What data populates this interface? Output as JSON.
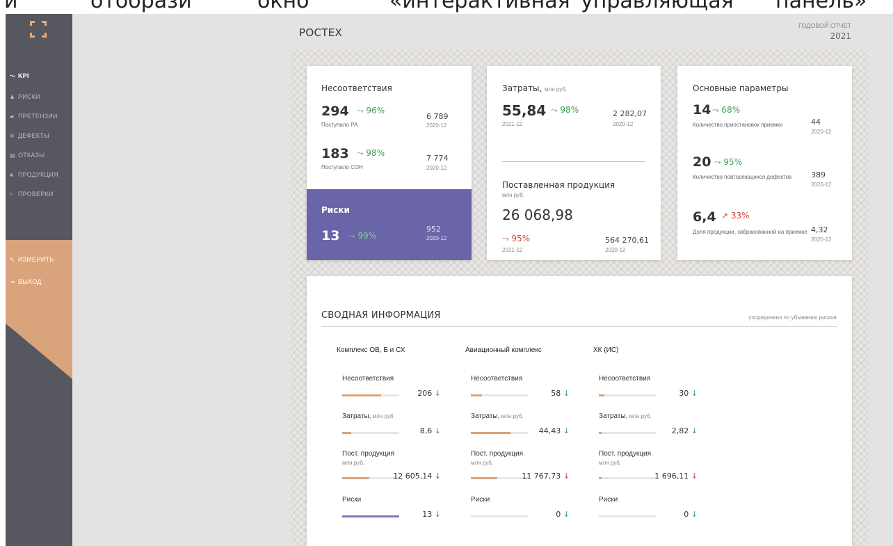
{
  "top_strip": [
    "и",
    "отобрази",
    "окно",
    "«интерактивная",
    "управляющая",
    "панель»"
  ],
  "sidebar": {
    "logo": "frame-logo",
    "items": [
      {
        "icon": "trend-icon",
        "glyph": "〜",
        "label": "KPI",
        "active": true
      },
      {
        "icon": "bell-icon",
        "glyph": "♟",
        "label": "РИСКИ"
      },
      {
        "icon": "speaker-icon",
        "glyph": "▰",
        "label": "ПРЕТЕНЗИИ"
      },
      {
        "icon": "gear-icon",
        "glyph": "✲",
        "label": "ДЕФЕКТЫ"
      },
      {
        "icon": "document-icon",
        "glyph": "▤",
        "label": "ОТКАЗЫ"
      },
      {
        "icon": "boxes-icon",
        "glyph": "♣",
        "label": "ПРОДУКЦИЯ"
      },
      {
        "icon": "waves-icon",
        "glyph": "≈",
        "label": "ПРОВЕРКИ"
      }
    ],
    "actions": [
      {
        "icon": "pencil-icon",
        "glyph": "✎",
        "label": "ИЗМЕНИТЬ"
      },
      {
        "icon": "logout-icon",
        "glyph": "⇥",
        "label": "ВЫХОД"
      }
    ]
  },
  "header": {
    "title": "РОСТЕХ",
    "report_label": "ГОДОВОЙ ОТЧЕТ",
    "report_year": "2021"
  },
  "card1": {
    "title": "Несоответствия",
    "rows": [
      {
        "value": "294",
        "pct": "96%",
        "label": "Поступило РА",
        "ref": "6 789",
        "ref_date": "2020-12"
      },
      {
        "value": "183",
        "pct": "98%",
        "label": "Поступило СОН",
        "ref": "7 774",
        "ref_date": "2020-12"
      }
    ],
    "risk": {
      "title": "Риски",
      "value": "13",
      "pct": "99%",
      "ref": "952",
      "ref_date": "2020-12"
    }
  },
  "card2": {
    "title": "Затраты,",
    "unit": "млн руб.",
    "value": "55,84",
    "pct": "98%",
    "date": "2021-12",
    "ref": "2 282,07",
    "ref_date": "2020-12",
    "prod_title": "Поставленная продукция",
    "prod_unit": "млн руб.",
    "prod_value": "26 068,98",
    "prod_pct": "95%",
    "prod_date": "2021-12",
    "prod_ref": "564 270,61",
    "prod_ref_date": "2020-12"
  },
  "card3": {
    "title": "Основные параметры",
    "rows": [
      {
        "value": "14",
        "pct": "68%",
        "trend": "down",
        "label": "Количество приостановок приемки",
        "ref": "44",
        "ref_date": "2020-12"
      },
      {
        "value": "20",
        "pct": "95%",
        "trend": "down",
        "label": "Количество повторяющихся дефектов",
        "ref": "389",
        "ref_date": "2020-12"
      },
      {
        "value": "6,4",
        "pct": "33%",
        "trend": "up",
        "label": "Доля продукции, забракованной на приемке",
        "ref": "4,32",
        "ref_date": "2020-12"
      }
    ]
  },
  "summary": {
    "title": "СВОДНАЯ ИНФОРМАЦИЯ",
    "note": "упорядочено по убыванию рисков",
    "metric_labels": {
      "nc": "Несоответствия",
      "cost": "Затраты,",
      "cost_unit": "млн руб.",
      "prod": "Пост. продукция",
      "prod_unit": "млн руб.",
      "risk": "Риски"
    },
    "colors": {
      "orange": "#d9a37c",
      "purple": "#7b79b8",
      "track": "#e6e6e6"
    },
    "columns": [
      {
        "name": "Комплекс ОВ, Б и СХ",
        "nc": {
          "value": "206",
          "fill": 0.68,
          "trend": "green"
        },
        "cost": {
          "value": "8,6",
          "fill": 0.16,
          "trend": "green"
        },
        "prod": {
          "value": "12 605,14",
          "fill": 0.48,
          "trend": "red"
        },
        "risk": {
          "value": "13",
          "fill": 1.0,
          "trend": "green"
        }
      },
      {
        "name": "Авиационный комплекс",
        "nc": {
          "value": "58",
          "fill": 0.2,
          "trend": "green"
        },
        "cost": {
          "value": "44,43",
          "fill": 0.7,
          "trend": "green"
        },
        "prod": {
          "value": "11 767,73",
          "fill": 0.46,
          "trend": "red"
        },
        "risk": {
          "value": "0",
          "fill": 0,
          "trend": "green"
        }
      },
      {
        "name": "ХК (ИС)",
        "nc": {
          "value": "30",
          "fill": 0.1,
          "trend": "green"
        },
        "cost": {
          "value": "2,82",
          "fill": 0.05,
          "trend": "green"
        },
        "prod": {
          "value": "1 696,11",
          "fill": 0.05,
          "trend": "red"
        },
        "risk": {
          "value": "0",
          "fill": 0,
          "trend": "green"
        }
      }
    ]
  }
}
